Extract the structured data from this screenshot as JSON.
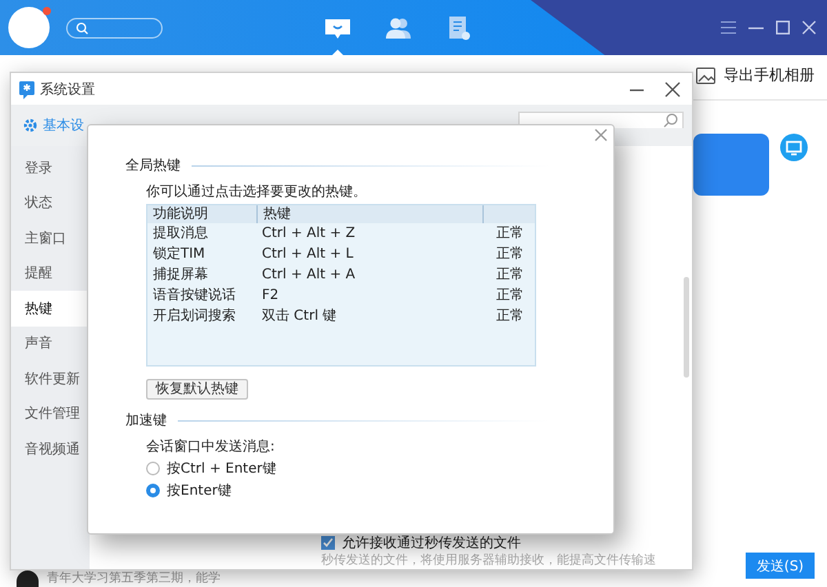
{
  "app": {
    "nav_tabs": [
      {
        "kind": "chat",
        "selected": true
      },
      {
        "kind": "contacts",
        "selected": false
      },
      {
        "kind": "files",
        "selected": false
      }
    ],
    "export_button": "导出手机相册",
    "chat_preview": "青年大学习第五季第三期，能学",
    "send_button": "发送(S)"
  },
  "settings": {
    "title": "系统设置",
    "tabs": [
      {
        "label": "基本设",
        "selected": true
      }
    ],
    "sidebar": [
      {
        "label": "登录",
        "selected": false
      },
      {
        "label": "状态",
        "selected": false
      },
      {
        "label": "主窗口",
        "selected": false
      },
      {
        "label": "提醒",
        "selected": false
      },
      {
        "label": "热键",
        "selected": true
      },
      {
        "label": "声音",
        "selected": false
      },
      {
        "label": "软件更新",
        "selected": false
      },
      {
        "label": "文件管理",
        "selected": false
      },
      {
        "label": "音视频通",
        "selected": false
      }
    ],
    "option": {
      "label": "允许接收通过秒传发送的文件",
      "checked": true,
      "note": "秒传发送的文件，将使用服务器辅助接收，能提高文件传输速"
    }
  },
  "dialog": {
    "hotkeys": {
      "title": "全局热键",
      "hint": "你可以通过点击选择要更改的热键。",
      "columns": [
        "功能说明",
        "热键"
      ],
      "rows": [
        {
          "function": "提取消息",
          "hotkey": "Ctrl + Alt + Z",
          "status": "正常"
        },
        {
          "function": "锁定TIM",
          "hotkey": "Ctrl + Alt + L",
          "status": "正常"
        },
        {
          "function": "捕捉屏幕",
          "hotkey": "Ctrl + Alt + A",
          "status": "正常"
        },
        {
          "function": "语音按键说话",
          "hotkey": "F2",
          "status": "正常"
        },
        {
          "function": "开启划词搜索",
          "hotkey": "双击 Ctrl 键",
          "status": "正常"
        }
      ],
      "restore_button": "恢复默认热键"
    },
    "accelerator": {
      "title": "加速键",
      "hint": "会话窗口中发送消息:",
      "options": [
        {
          "label": "按Ctrl + Enter键",
          "selected": false
        },
        {
          "label": "按Enter键",
          "selected": true
        }
      ]
    }
  }
}
